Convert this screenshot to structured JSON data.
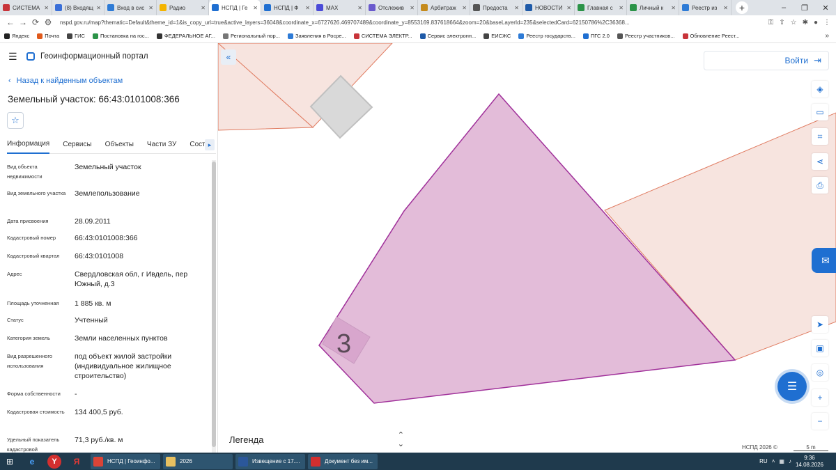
{
  "browser": {
    "tabs": [
      {
        "label": "СИСТЕМА",
        "color": "#c8343a"
      },
      {
        "label": "(8) Входящ",
        "color": "#3a6fd8"
      },
      {
        "label": "Вход в сис",
        "color": "#2e7bd6"
      },
      {
        "label": "Радио",
        "color": "#f4b400"
      },
      {
        "label": "НСПД | Ге",
        "color": "#1f6fd1",
        "active": true
      },
      {
        "label": "НСПД | Ф",
        "color": "#1f6fd1"
      },
      {
        "label": "MAX",
        "color": "#4b4bd8"
      },
      {
        "label": "Отслежив",
        "color": "#6a5acd"
      },
      {
        "label": "Арбитраж",
        "color": "#c58a1b"
      },
      {
        "label": "Предоста",
        "color": "#555555"
      },
      {
        "label": "НОВОСТИ",
        "color": "#1e5aa8"
      },
      {
        "label": "Главная с",
        "color": "#2b9348"
      },
      {
        "label": "Личный к",
        "color": "#2b9348"
      },
      {
        "label": "Реестр из",
        "color": "#2e7bd6"
      }
    ],
    "url": "nspd.gov.ru/map?thematic=Default&theme_id=1&is_copy_url=true&active_layers=36048&coordinate_x=6727626.469707489&coordinate_y=8553169.837618664&zoom=20&baseLayerId=235&selectedCard=62150786%2C36368...",
    "bookmarks": [
      {
        "label": "Яндекс",
        "color": "#222222"
      },
      {
        "label": "Почта",
        "color": "#e05a1c"
      },
      {
        "label": "ГИС",
        "color": "#444444"
      },
      {
        "label": "Постановка на гос...",
        "color": "#2b9348"
      },
      {
        "label": "ФЕДЕРАЛЬНОЕ АГ...",
        "color": "#333333"
      },
      {
        "label": "Региональный пор...",
        "color": "#777777"
      },
      {
        "label": "Заявления в Росре...",
        "color": "#2e7bd6"
      },
      {
        "label": "СИСТЕМА ЭЛЕКТР...",
        "color": "#c8343a"
      },
      {
        "label": "Сервис электронн...",
        "color": "#1e5aa8"
      },
      {
        "label": "ЕИСЖС",
        "color": "#444444"
      },
      {
        "label": "Реестр государств...",
        "color": "#2e7bd6"
      },
      {
        "label": "ПГС 2.0",
        "color": "#1f6fd1"
      },
      {
        "label": "Реестр участников...",
        "color": "#555555"
      },
      {
        "label": "Обновление Реест...",
        "color": "#c8343a"
      }
    ],
    "bookmarks_more": "»"
  },
  "header": {
    "portal_title": "Геоинформационный портал"
  },
  "panel": {
    "back_label": "Назад к найденным объектам",
    "title": "Земельный участок: 66:43:0101008:366",
    "tabs": [
      {
        "label": "Информация",
        "active": true
      },
      {
        "label": "Сервисы"
      },
      {
        "label": "Объекты"
      },
      {
        "label": "Части ЗУ"
      },
      {
        "label": "Состав"
      }
    ],
    "rows": [
      {
        "label": "Вид объекта недвижимости",
        "value": "Земельный участок"
      },
      {
        "label": "Вид земельного участка",
        "value": "Землепользование"
      },
      {
        "label": "Дата присвоения",
        "value": "28.09.2011"
      },
      {
        "label": "Кадастровый номер",
        "value": "66:43:0101008:366"
      },
      {
        "label": "Кадастровый квартал",
        "value": "66:43:0101008"
      },
      {
        "label": "Адрес",
        "value": "Свердловская обл, г Ивдель, пер Южный, д.3"
      },
      {
        "label": "Площадь уточненная",
        "value": "1 885 кв. м"
      },
      {
        "label": "Статус",
        "value": "Учтенный"
      },
      {
        "label": "Категория земель",
        "value": "Земли населенных пунктов"
      },
      {
        "label": "Вид разрешенного использования",
        "value": "под объект жилой застройки (индивидуальное жилищное строительство)"
      },
      {
        "label": "Форма собственности",
        "value": "-"
      },
      {
        "label": "Кадастровая стоимость",
        "value": "134 400,5 руб."
      },
      {
        "label": "Удельный показатель кадастровой",
        "value": "71,3 руб./кв. м"
      }
    ]
  },
  "map": {
    "login_label": "Войти",
    "house_number": "3",
    "legend_label": "Легенда",
    "attribution": "НСПД 2026 ©",
    "scale_label": "5 m",
    "colors": {
      "parcel_fill": "#e3bcd9",
      "parcel_stroke": "#a0309a",
      "neighbor_fill": "#f7e4df",
      "neighbor_stroke": "#e07a5f",
      "accent": "#1f6fd1"
    }
  },
  "taskbar": {
    "apps": [
      {
        "label": "НСПД | Геоинфо...",
        "color": "#db4437"
      },
      {
        "label": "2026",
        "color": "#e8c060"
      },
      {
        "label": "Извещение с 17....",
        "color": "#2b579a"
      },
      {
        "label": "Документ без им...",
        "color": "#d32f2f"
      }
    ],
    "lang": "RU",
    "time": "9:36",
    "date": "14.08.2026"
  }
}
